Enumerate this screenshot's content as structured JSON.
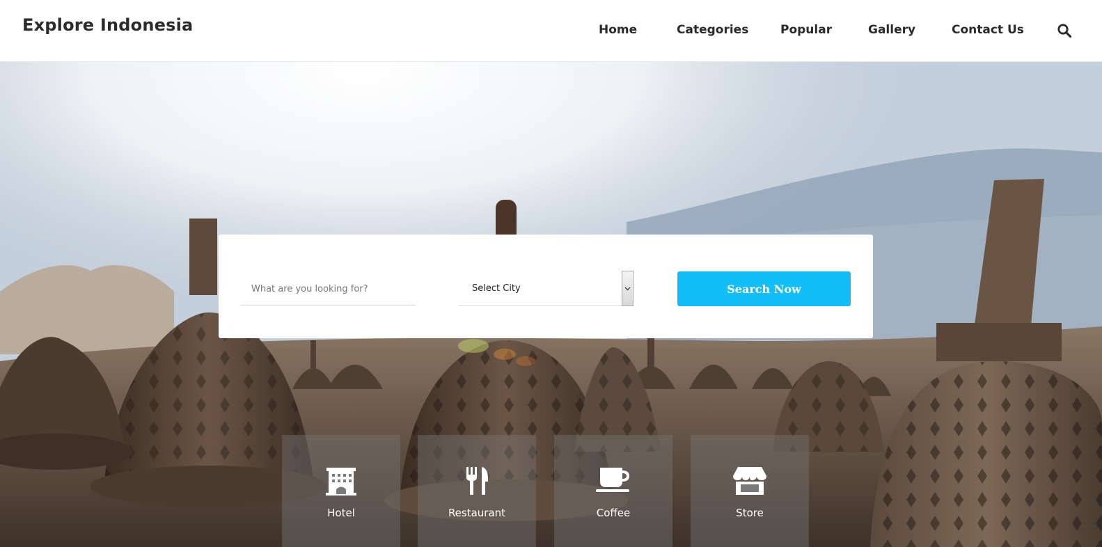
{
  "header": {
    "brand": "Explore Indonesia",
    "nav": [
      "Home",
      "Categories",
      "Popular",
      "Gallery",
      "Contact Us"
    ],
    "search_icon": "search-icon"
  },
  "search": {
    "placeholder": "What are you looking for?",
    "city_value": "Select City",
    "button_label": "Search Now",
    "button_color": "#13bdf5"
  },
  "categories": [
    {
      "label": "Hotel",
      "icon": "hotel-icon"
    },
    {
      "label": "Restaurant",
      "icon": "restaurant-icon"
    },
    {
      "label": "Coffee",
      "icon": "coffee-icon"
    },
    {
      "label": "Store",
      "icon": "store-icon"
    }
  ]
}
